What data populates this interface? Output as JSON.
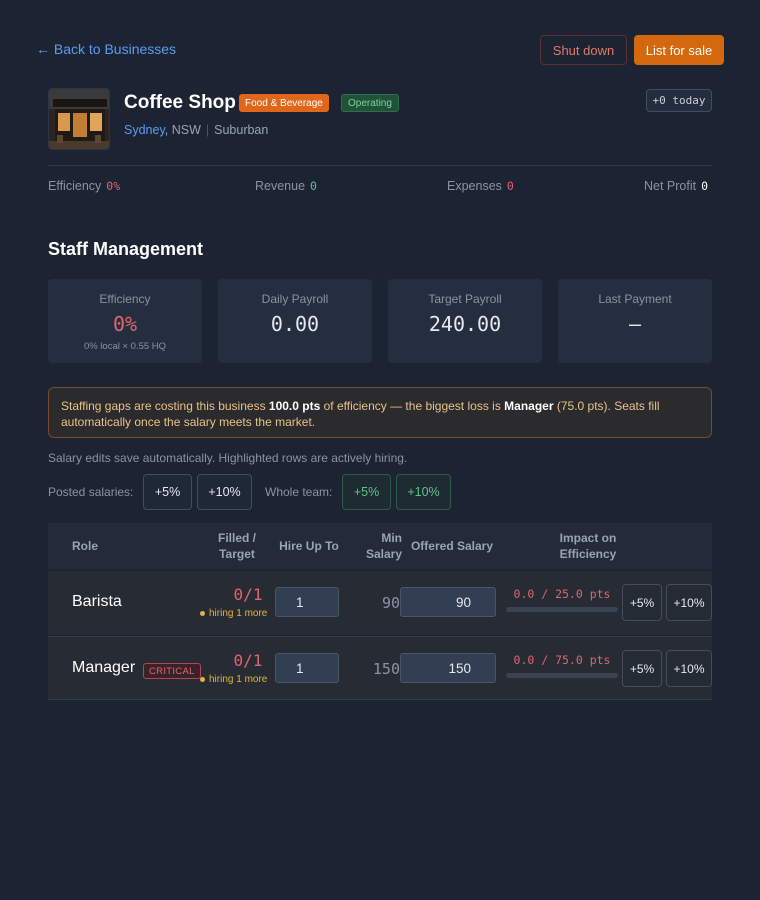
{
  "nav": {
    "back_label": "← Back to Businesses"
  },
  "actions": {
    "shutdown_label": "Shut down",
    "sell_label": "List for sale",
    "today_label": "+0 today"
  },
  "business": {
    "name": "Coffee Shop",
    "category": "Food & Beverage",
    "status": "Operating",
    "city": "Sydney",
    "state": ", NSW",
    "area": "Suburban"
  },
  "stats": [
    {
      "label": "Efficiency",
      "value": "0%"
    },
    {
      "label": "Revenue",
      "value": "0"
    },
    {
      "label": "Expenses",
      "value": "0"
    },
    {
      "label": "Net Profit",
      "value": "0"
    }
  ],
  "section_title": "Staff Management",
  "cards": [
    {
      "label": "Efficiency",
      "value": "0%",
      "sub": "0% local × 0.55 HQ"
    },
    {
      "label": "Daily Payroll",
      "value": "0.00"
    },
    {
      "label": "Target Payroll",
      "value": "240.00"
    },
    {
      "label": "Last Payment",
      "value": "–"
    }
  ],
  "alert": {
    "t1": "Staffing gaps are costing this business ",
    "b1": "100.0 pts",
    "t2": " of efficiency — the biggest loss is ",
    "b2": "Manager",
    "t3": " (75.0 pts). Seats fill automatically once the salary meets the market."
  },
  "note": "Salary edits save automatically. Highlighted rows are actively hiring.",
  "bulk": {
    "posted_label": "Posted salaries:",
    "team_label": "Whole team:",
    "plus5": "+5%",
    "plus10": "+10%"
  },
  "table": {
    "headers": {
      "role": "Role",
      "filled_1": "Filled /",
      "filled_2": "Target",
      "hire": "Hire Up To",
      "min_1": "Min",
      "min_2": "Salary",
      "offered": "Offered Salary",
      "impact_1": "Impact on",
      "impact_2": "Efficiency"
    },
    "rows": [
      {
        "role": "Barista",
        "badge": "",
        "filled": "0/1",
        "hiring": "hiring 1 more",
        "hire_up_to": "1",
        "min_salary": "90",
        "offered": "90",
        "impact": "0.0 / 25.0 pts",
        "impact_fraction": 0,
        "btn5": "+5%",
        "btn10": "+10%"
      },
      {
        "role": "Manager",
        "badge": "CRITICAL",
        "filled": "0/1",
        "hiring": "hiring 1 more",
        "hire_up_to": "1",
        "min_salary": "150",
        "offered": "150",
        "impact": "0.0 / 75.0 pts",
        "impact_fraction": 0,
        "btn5": "+5%",
        "btn10": "+10%"
      }
    ]
  },
  "colors": {
    "accent": "#5b9cf0",
    "warning": "#e3b341",
    "danger": "#e0646b",
    "success": "#5cc488",
    "sale": "#d4680f"
  }
}
